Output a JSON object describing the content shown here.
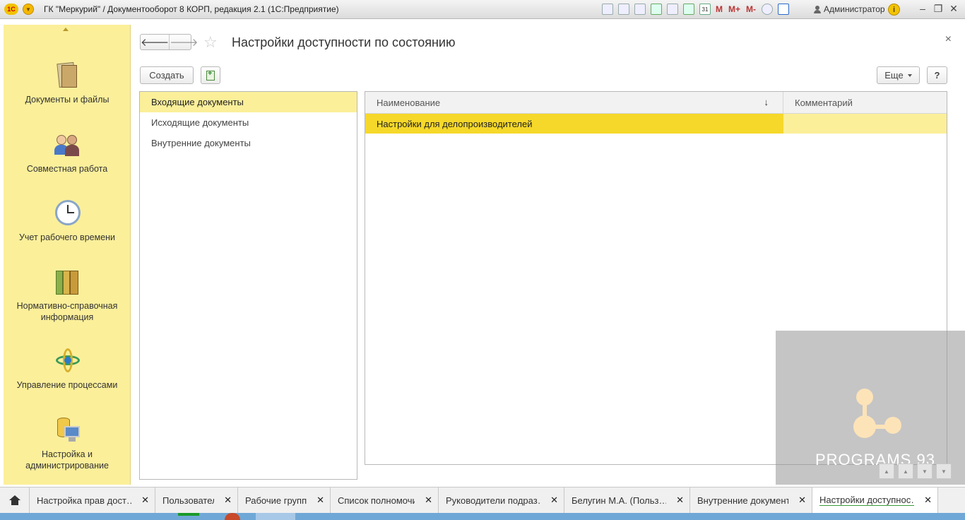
{
  "window": {
    "title": "ГК \"Меркурий\" / Документооборот 8 КОРП, редакция 2.1  (1С:Предприятие)",
    "logo_text": "1С",
    "user": "Администратор",
    "toolbar_m": [
      "M",
      "M+",
      "M-"
    ],
    "calendar_day": "31"
  },
  "sidebar": {
    "items": [
      {
        "label": "Документы и файлы",
        "icon": "documents-files-icon"
      },
      {
        "label": "Совместная работа",
        "icon": "collaboration-icon"
      },
      {
        "label": "Учет рабочего времени",
        "icon": "clock-icon"
      },
      {
        "label": "Нормативно-справочная информация",
        "icon": "reference-folders-icon"
      },
      {
        "label": "Управление процессами",
        "icon": "process-icon"
      },
      {
        "label": "Настройка и администрирование",
        "icon": "admin-icon"
      }
    ]
  },
  "form": {
    "title": "Настройки доступности по состоянию",
    "create_label": "Создать",
    "more_label": "Еще",
    "help_label": "?"
  },
  "left_list": {
    "items": [
      "Входящие документы",
      "Исходящие документы",
      "Внутренние документы"
    ],
    "selected": "Входящие документы"
  },
  "grid": {
    "columns": [
      "Наименование",
      "Комментарий"
    ],
    "sort_indicator": "↓",
    "rows": [
      {
        "name": "Настройки для делопроизводителей",
        "comment": ""
      }
    ]
  },
  "watermark": {
    "text": "PROGRAMS 93"
  },
  "tabs": [
    {
      "label": "Настройка прав дост…"
    },
    {
      "label": "Пользователи"
    },
    {
      "label": "Рабочие группы"
    },
    {
      "label": "Список полномочий"
    },
    {
      "label": "Руководители подраз…"
    },
    {
      "label": "Белугин М.А. (Польз…"
    },
    {
      "label": "Внутренние документы"
    },
    {
      "label": "Настройки доступнос…",
      "active": true
    }
  ],
  "colors": {
    "sidebar_bg": "#fbef9a",
    "selection": "#f6d82a",
    "selection_light": "#fbef9a"
  }
}
